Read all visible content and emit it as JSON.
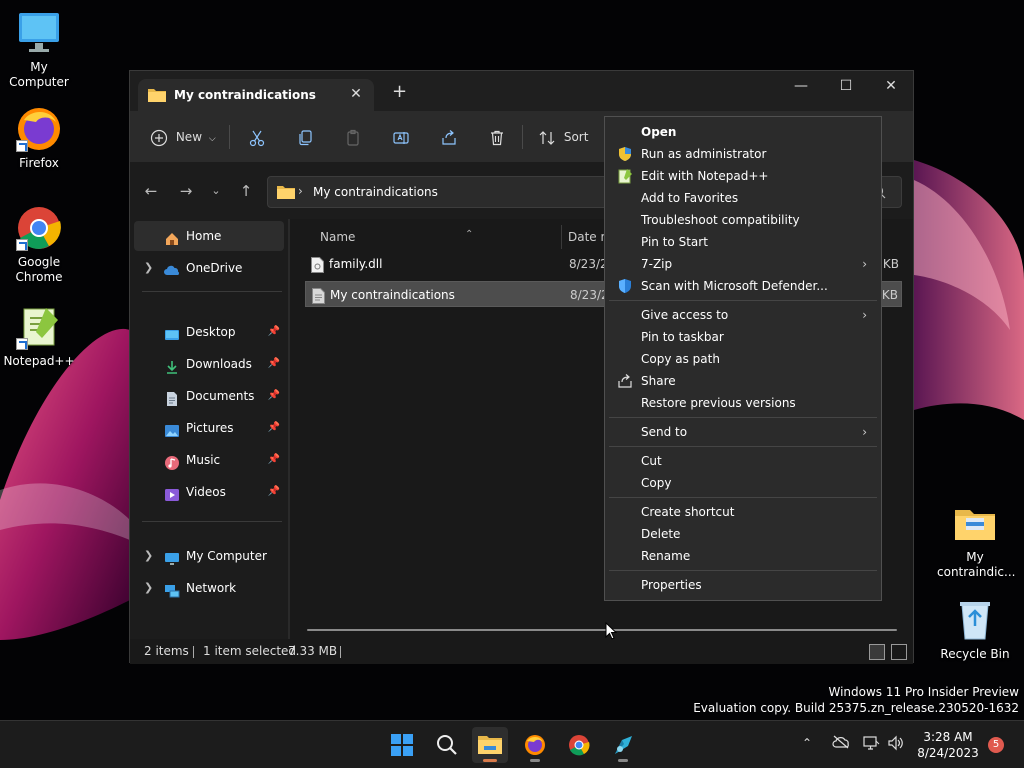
{
  "desktop": {
    "icons": [
      {
        "label": "My Computer"
      },
      {
        "label": "Firefox"
      },
      {
        "label": "Google Chrome"
      },
      {
        "label": "Notepad++"
      },
      {
        "label": "My contraindic..."
      },
      {
        "label": "Recycle Bin"
      }
    ],
    "watermark": {
      "line1": "Windows 11 Pro Insider Preview",
      "line2": "Evaluation copy. Build 25375.zn_release.230520-1632"
    }
  },
  "explorer": {
    "tab_title": "My contraindications",
    "tab_close": "✕",
    "new_tab": "+",
    "window_controls": {
      "minimize": "—",
      "maximize": "☐",
      "close": "✕"
    },
    "toolbar": {
      "new_label": "New",
      "sort_label": "Sort"
    },
    "address": {
      "path": "My contraindications"
    },
    "nav": {
      "home": "Home",
      "onedrive": "OneDrive",
      "desktop": "Desktop",
      "downloads": "Downloads",
      "documents": "Documents",
      "pictures": "Pictures",
      "music": "Music",
      "videos": "Videos",
      "my_computer": "My Computer",
      "network": "Network"
    },
    "columns": {
      "name": "Name",
      "date": "Date m"
    },
    "files": [
      {
        "name": "family.dll",
        "date": "8/23/20",
        "size": "KB"
      },
      {
        "name": "My contraindications",
        "date": "8/23/20",
        "size": "KB"
      }
    ],
    "status": {
      "items": "2 items",
      "selected": "1 item selected",
      "size": "7.33 MB"
    }
  },
  "context_menu": {
    "open": "Open",
    "run_admin": "Run as administrator",
    "edit_notepad": "Edit with Notepad++",
    "add_favorites": "Add to Favorites",
    "troubleshoot": "Troubleshoot compatibility",
    "pin_start": "Pin to Start",
    "zip": "7-Zip",
    "defender": "Scan with Microsoft Defender...",
    "give_access": "Give access to",
    "pin_taskbar": "Pin to taskbar",
    "copy_path": "Copy as path",
    "share": "Share",
    "restore": "Restore previous versions",
    "send_to": "Send to",
    "cut": "Cut",
    "copy": "Copy",
    "create_shortcut": "Create shortcut",
    "delete": "Delete",
    "rename": "Rename",
    "properties": "Properties",
    "submenu_arrow": "›"
  },
  "taskbar": {
    "clock_time": "3:28 AM",
    "clock_date": "8/24/2023",
    "notification_count": "5"
  },
  "colors": {
    "accent": "#0078d4",
    "selection": "#4d4d4d",
    "menu_bg": "#2b2b2b",
    "notification_badge": "#e05a4f"
  }
}
